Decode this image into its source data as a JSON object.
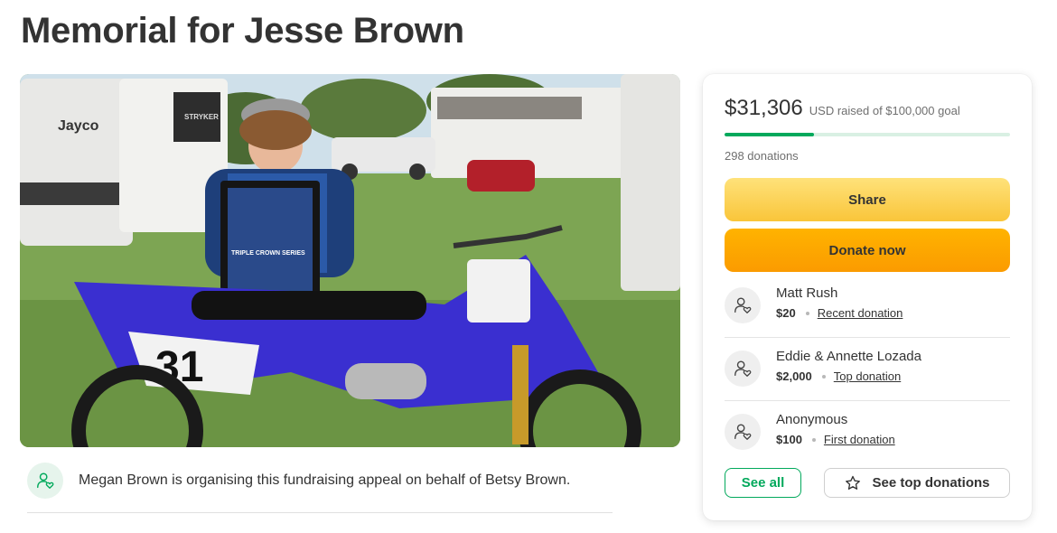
{
  "page": {
    "title": "Memorial for Jesse Brown"
  },
  "hero": {
    "image_label": "Photo of Jesse Brown with a trophy plaque and a blue number 31 dirt bike at a campground",
    "trailer_brand": "Jayco",
    "trailer_model": "STRYKER",
    "bike_number": "31",
    "plaque_text": "TRIPLE CROWN SERIES"
  },
  "organiser": {
    "text": "Megan Brown is organising this fundraising appeal on behalf of Betsy Brown."
  },
  "fundraiser": {
    "raised_amount": "$31,306",
    "raised_label": "USD raised of $100,000 goal",
    "progress_fraction": 0.313,
    "donation_count": "298 donations",
    "share_label": "Share",
    "donate_label": "Donate now",
    "donations": [
      {
        "name": "Matt Rush",
        "amount": "$20",
        "tag": "Recent donation"
      },
      {
        "name": "Eddie & Annette Lozada",
        "amount": "$2,000",
        "tag": "Top donation"
      },
      {
        "name": "Anonymous",
        "amount": "$100",
        "tag": "First donation"
      }
    ],
    "see_all_label": "See all",
    "see_top_label": "See top donations"
  },
  "colors": {
    "brand_green": "#02a95c",
    "share_yellow": "#f9c53a",
    "donate_orange": "#fb9b00"
  }
}
